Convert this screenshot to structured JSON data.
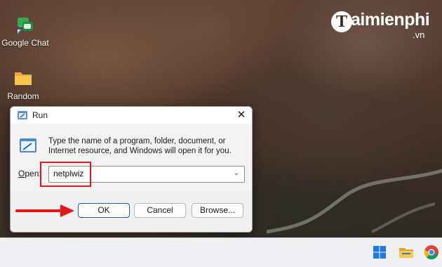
{
  "watermark": {
    "logo_letter": "T",
    "brand": "aimienphi",
    "suffix": ".vn"
  },
  "desktop": {
    "icons": [
      {
        "label": "Google Chat",
        "icon": "google-chat-icon"
      },
      {
        "label": "Random",
        "icon": "folder-icon"
      }
    ]
  },
  "run_dialog": {
    "title": "Run",
    "close_glyph": "✕",
    "description": "Type the name of a program, folder, document, or Internet resource, and Windows will open it for you.",
    "open_label_accel": "O",
    "open_label_rest": "pen:",
    "open_value": "netplwiz",
    "dropdown_glyph": "⌄",
    "buttons": {
      "ok": "OK",
      "cancel": "Cancel",
      "browse": "Browse..."
    }
  },
  "taskbar": {
    "icons": [
      "windows-start-icon",
      "file-explorer-icon",
      "chrome-icon"
    ]
  },
  "colors": {
    "highlight": "#e8141b",
    "accent": "#1f5fb5",
    "taskbar": "#eef0f4"
  }
}
